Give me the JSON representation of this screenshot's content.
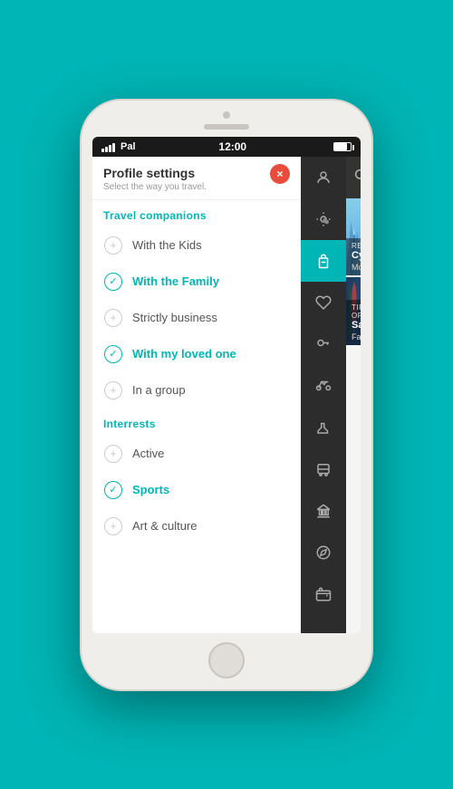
{
  "status_bar": {
    "carrier": "Pal",
    "time": "12:00"
  },
  "profile_header": {
    "title": "Profile settings",
    "subtitle": "Select the way you travel."
  },
  "close_button": "×",
  "sections": {
    "travel_companions": {
      "heading": "Travel companions",
      "items": [
        {
          "id": "kids",
          "label": "With the Kids",
          "active": false
        },
        {
          "id": "family",
          "label": "With the Family",
          "active": true
        },
        {
          "id": "business",
          "label": "Strictly business",
          "active": false
        },
        {
          "id": "loved_one",
          "label": "With my loved one",
          "active": true
        },
        {
          "id": "group",
          "label": "In a group",
          "active": false
        }
      ]
    },
    "interests": {
      "heading": "Interrests",
      "items": [
        {
          "id": "active",
          "label": "Active",
          "active": false
        },
        {
          "id": "sports",
          "label": "Sports",
          "active": true
        },
        {
          "id": "art",
          "label": "Art & culture",
          "active": false
        }
      ]
    }
  },
  "mid_bar_icons": [
    {
      "id": "profile",
      "symbol": "👤",
      "active": false
    },
    {
      "id": "weather",
      "symbol": "⛅",
      "active": false
    },
    {
      "id": "luggage",
      "symbol": "💼",
      "active": true
    },
    {
      "id": "heart",
      "symbol": "♥",
      "active": false
    },
    {
      "id": "key",
      "symbol": "🔑",
      "active": false
    },
    {
      "id": "bike",
      "symbol": "🚲",
      "active": false
    },
    {
      "id": "boot",
      "symbol": "👢",
      "active": false
    },
    {
      "id": "bus",
      "symbol": "🚌",
      "active": false
    },
    {
      "id": "bank",
      "symbol": "🏦",
      "active": false
    },
    {
      "id": "compass",
      "symbol": "🧭",
      "active": false
    },
    {
      "id": "wallet",
      "symbol": "👛",
      "active": false
    }
  ],
  "right_panel": {
    "cards": [
      {
        "id": "cycling",
        "tag": "Recom",
        "title": "Cycl",
        "subtitle": "Mount"
      },
      {
        "id": "saze",
        "tag": "Tips of",
        "title": "Saze",
        "subtitle": "Family"
      }
    ]
  }
}
